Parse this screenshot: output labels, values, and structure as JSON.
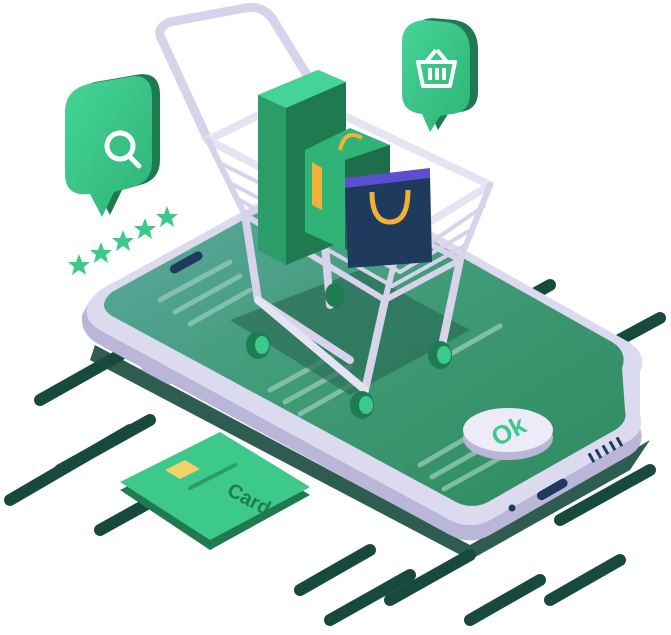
{
  "illustration": {
    "card": {
      "label": "Card"
    },
    "ok_button": {
      "label": "Ok"
    },
    "rating": {
      "stars": 5
    },
    "icons": {
      "search_bubble": "search-icon",
      "basket_bubble": "basket-icon",
      "cart": "shopping-cart-icon"
    },
    "colors": {
      "brand_green": "#3CC98A",
      "dark_green": "#1F5E4A",
      "screen_green": "#3D9471",
      "navy": "#1E3A5C",
      "bag_handle": "#F2B035",
      "phone_body": "#D9D8EC",
      "speed_lines": "#174A3D"
    }
  }
}
